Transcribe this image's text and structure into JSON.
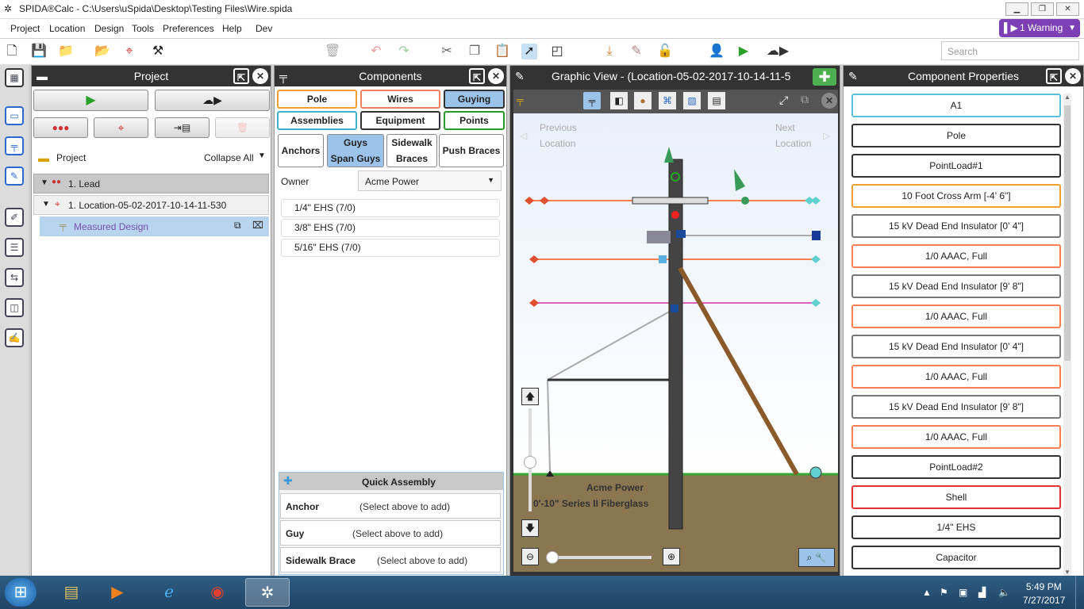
{
  "window": {
    "title": "SPIDA®Calc - C:\\Users\\uSpida\\Desktop\\Testing Files\\Wire.spida"
  },
  "menu": [
    "Project",
    "Location",
    "Design",
    "Tools",
    "Preferences",
    "Help",
    "Dev"
  ],
  "warning": {
    "label": "1 Warning"
  },
  "search": {
    "placeholder": "Search"
  },
  "project_panel": {
    "title": "Project",
    "header_label": "Project",
    "collapse_label": "Collapse All",
    "tree": [
      {
        "label": "1.  Lead"
      },
      {
        "label": "1.  Location-05-02-2017-10-14-11-530"
      },
      {
        "label": "Measured Design"
      }
    ]
  },
  "components_panel": {
    "title": "Components",
    "tabs_row1": [
      "Pole",
      "Wires",
      "Guying"
    ],
    "tabs_row2": [
      "Assemblies",
      "Equipment",
      "Points"
    ],
    "subtabs": [
      "Anchors",
      "Guys\nSpan Guys",
      "Sidewalk\nBraces",
      "Push Braces"
    ],
    "owner_label": "Owner",
    "owner_value": "Acme Power",
    "items": [
      "1/4\" EHS (7/0)",
      "3/8\" EHS (7/0)",
      "5/16\" EHS (7/0)"
    ],
    "quick_assembly": {
      "title": "Quick Assembly",
      "rows": [
        {
          "label": "Anchor",
          "value": "(Select above to add)"
        },
        {
          "label": "Guy",
          "value": "(Select above to add)"
        },
        {
          "label": "Sidewalk Brace",
          "value": "(Select above to add)"
        }
      ]
    }
  },
  "graphic_panel": {
    "title": "Graphic View - (Location-05-02-2017-10-14-11-5",
    "prev_label": "Previous\nLocation",
    "next_label": "Next\nLocation",
    "owner_text": "Acme Power",
    "pole_text": "0'-10\" Series II Fiberglass",
    "zoom_level": 0.0,
    "colors": {
      "primary": "#ff7f50",
      "neutral": "#e060c0",
      "guy": "#aaaaaa",
      "brace": "#8b5a2b",
      "ground": "#8a7650",
      "sky": "#e8f0fa"
    }
  },
  "properties_panel": {
    "title": "Component Properties",
    "items": [
      {
        "label": "A1",
        "color": "#5bc0de"
      },
      {
        "label": "Pole",
        "color": "#333333"
      },
      {
        "label": "PointLoad#1",
        "color": "#333333"
      },
      {
        "label": "10 Foot Cross Arm [-4' 6\"]",
        "color": "#f0a030"
      },
      {
        "label": "15 kV Dead End Insulator [0' 4\"]",
        "color": "#777777"
      },
      {
        "label": "1/0 AAAC, Full",
        "color": "#ff7f50"
      },
      {
        "label": "15 kV Dead End Insulator [9' 8\"]",
        "color": "#777777"
      },
      {
        "label": "1/0 AAAC, Full",
        "color": "#ff7f50"
      },
      {
        "label": "15 kV Dead End Insulator [0' 4\"]",
        "color": "#777777"
      },
      {
        "label": "1/0 AAAC, Full",
        "color": "#ff7f50"
      },
      {
        "label": "15 kV Dead End Insulator [9' 8\"]",
        "color": "#777777"
      },
      {
        "label": "1/0 AAAC, Full",
        "color": "#ff7f50"
      },
      {
        "label": "PointLoad#2",
        "color": "#333333"
      },
      {
        "label": "Shell",
        "color": "#e03030"
      },
      {
        "label": "1/4\" EHS",
        "color": "#333333"
      },
      {
        "label": "Capacitor",
        "color": "#333333"
      }
    ]
  },
  "taskbar": {
    "time": "5:49 PM",
    "date": "7/27/2017"
  }
}
